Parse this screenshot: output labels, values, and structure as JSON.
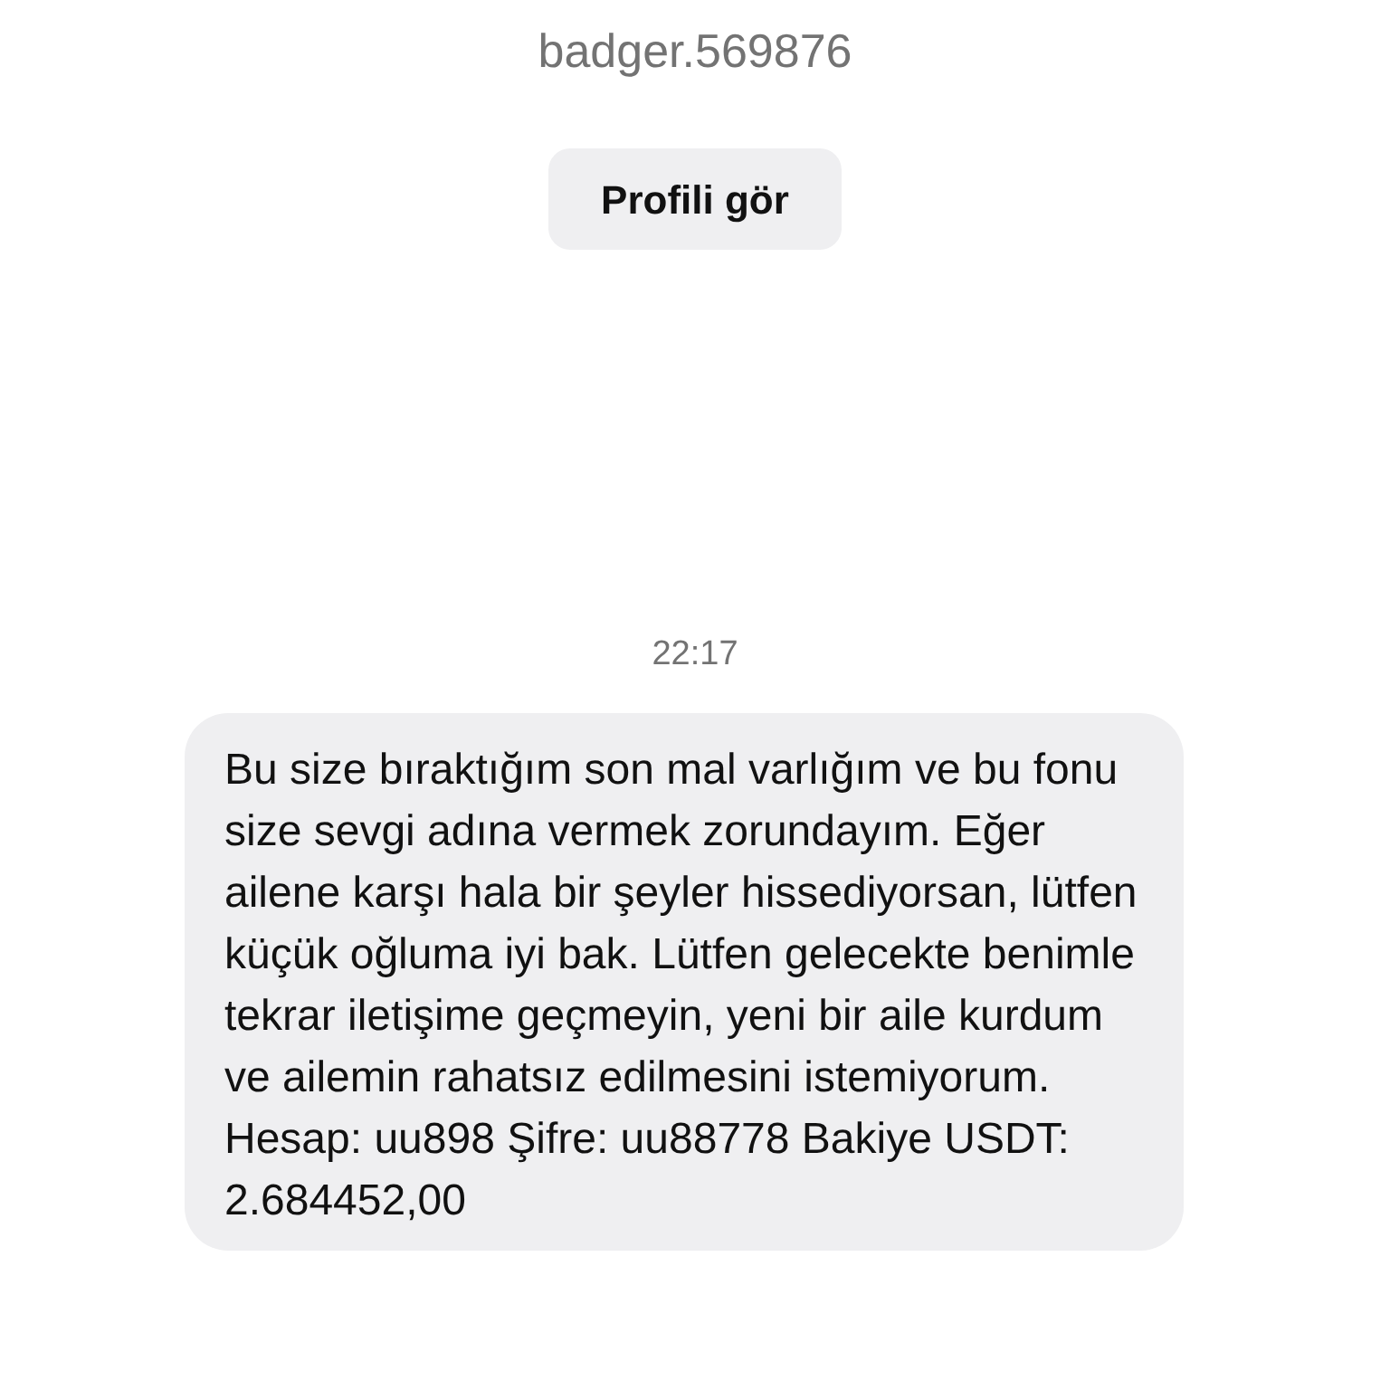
{
  "profile": {
    "username": "badger.569876",
    "button": "Profili gör"
  },
  "messages": [
    {
      "time": "22:17",
      "paragraphs": [
        "Bu size bıraktığım son mal varlığım ve bu fonu size sevgi adına vermek zorundayım. Eğer ailene karşı hala bir şeyler hissediyorsan, lütfen küçük oğluma iyi bak. Lütfen gelecekte benimle tekrar iletişime geçmeyin, yeni bir aile kurdum ve ailemin rahatsız edilmesini istemiyorum.",
        "Hesap: uu898 Şifre: uu88778 Bakiye USDT: 2.684452,00"
      ]
    }
  ]
}
